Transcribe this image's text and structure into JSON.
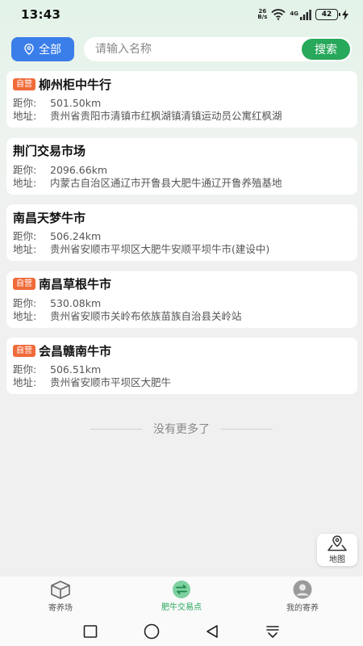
{
  "status": {
    "time": "13:43",
    "net_speed_top": "26",
    "net_speed_bottom": "B/s",
    "signal": "4G",
    "battery": "42"
  },
  "search": {
    "city": "全部",
    "placeholder": "请输入名称",
    "button": "搜索"
  },
  "labels": {
    "distance": "距你:",
    "address": "地址:"
  },
  "markets": [
    {
      "tag": "自营",
      "name": "柳州柜中牛行",
      "distance": "501.50km",
      "address": "贵州省贵阳市清镇市红枫湖镇清镇运动员公寓红枫湖"
    },
    {
      "tag": "",
      "name": "荆门交易市场",
      "distance": "2096.66km",
      "address": "内蒙古自治区通辽市开鲁县大肥牛通辽开鲁养殖基地"
    },
    {
      "tag": "",
      "name": "南昌天梦牛市",
      "distance": "506.24km",
      "address": "贵州省安顺市平坝区大肥牛安顺平坝牛市(建设中)"
    },
    {
      "tag": "自营",
      "name": "南昌草根牛市",
      "distance": "530.08km",
      "address": "贵州省安顺市关岭布依族苗族自治县关岭站"
    },
    {
      "tag": "自营",
      "name": "会昌赣南牛市",
      "distance": "506.51km",
      "address": "贵州省安顺市平坝区大肥牛"
    }
  ],
  "no_more": "没有更多了",
  "map_button": "地图",
  "tabs": [
    {
      "label": "寄养场",
      "icon": "box-icon"
    },
    {
      "label": "肥牛交易点",
      "icon": "exchange-icon"
    },
    {
      "label": "我的寄养",
      "icon": "avatar-icon"
    }
  ],
  "colors": {
    "accent_green": "#27a85a",
    "city_blue": "#3a7ee9",
    "tag_orange": "#ef6b3a"
  }
}
